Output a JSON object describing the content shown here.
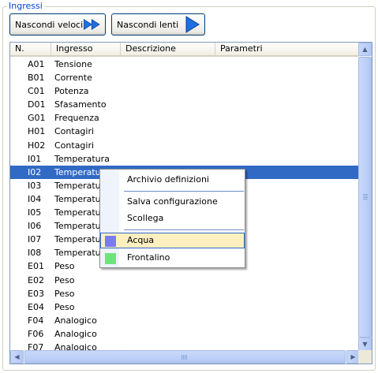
{
  "group": {
    "title": "Ingressi"
  },
  "toolbar": {
    "fast_label": "Nascondi veloci",
    "slow_label": "Nascondi lenti",
    "fast_icon": "double-right-arrow-icon",
    "slow_icon": "right-arrow-icon",
    "icon_color": "#1e6fe0"
  },
  "table": {
    "columns": [
      "N.",
      "Ingresso",
      "Descrizione",
      "Parametri"
    ],
    "rows": [
      {
        "n": "A01",
        "ingresso": "Tensione"
      },
      {
        "n": "B01",
        "ingresso": "Corrente"
      },
      {
        "n": "C01",
        "ingresso": "Potenza"
      },
      {
        "n": "D01",
        "ingresso": "Sfasamento"
      },
      {
        "n": "G01",
        "ingresso": "Frequenza"
      },
      {
        "n": "H01",
        "ingresso": "Contagiri"
      },
      {
        "n": "H02",
        "ingresso": "Contagiri"
      },
      {
        "n": "I01",
        "ingresso": "Temperatura"
      },
      {
        "n": "I02",
        "ingresso": "Temperatura",
        "selected": true
      },
      {
        "n": "I03",
        "ingresso": "Temperatura"
      },
      {
        "n": "I04",
        "ingresso": "Temperatura"
      },
      {
        "n": "I05",
        "ingresso": "Temperatura"
      },
      {
        "n": "I06",
        "ingresso": "Temperatura"
      },
      {
        "n": "I07",
        "ingresso": "Temperatura"
      },
      {
        "n": "I08",
        "ingresso": "Temperatura"
      },
      {
        "n": "E01",
        "ingresso": "Peso"
      },
      {
        "n": "E02",
        "ingresso": "Peso"
      },
      {
        "n": "E03",
        "ingresso": "Peso"
      },
      {
        "n": "E04",
        "ingresso": "Peso"
      },
      {
        "n": "F04",
        "ingresso": "Analogico"
      },
      {
        "n": "F06",
        "ingresso": "Analogico"
      },
      {
        "n": "F07",
        "ingresso": "Analogico"
      }
    ],
    "selection_color": "#316ac5"
  },
  "context_menu": {
    "items": [
      {
        "label": "Archivio definizioni"
      },
      {
        "label": "Salva configurazione"
      },
      {
        "label": "Scollega"
      },
      {
        "label": "Acqua",
        "swatch": "#7b7bf0",
        "highlighted": true
      },
      {
        "label": "Frontalino",
        "swatch": "#6fe37a"
      }
    ]
  }
}
